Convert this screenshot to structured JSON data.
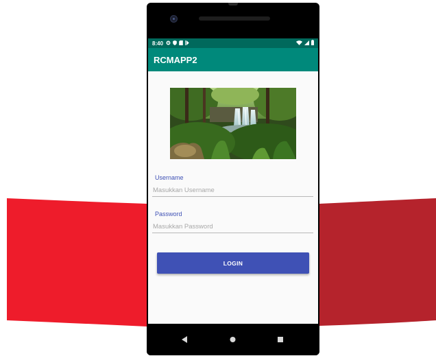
{
  "status_bar": {
    "time": "8:40",
    "left_icons": [
      "settings-icon",
      "shield-icon",
      "sim-card-icon",
      "play-icon"
    ],
    "right_icons": [
      "wifi-icon",
      "signal-icon",
      "battery-icon"
    ]
  },
  "app_bar": {
    "title": "RCMAPP2"
  },
  "form": {
    "username_label": "Username",
    "username_placeholder": "Masukkan Username",
    "password_label": "Password",
    "password_placeholder": "Masukkan Password",
    "login_label": "LOGIN"
  },
  "nav_bar": {
    "buttons": [
      "back-icon",
      "home-icon",
      "recents-icon"
    ]
  },
  "colors": {
    "status_bar": "#00695c",
    "app_bar": "#00897b",
    "primary": "#3f51b5",
    "ribbon_left": "#ee1c2b",
    "ribbon_right": "#b5232c"
  }
}
